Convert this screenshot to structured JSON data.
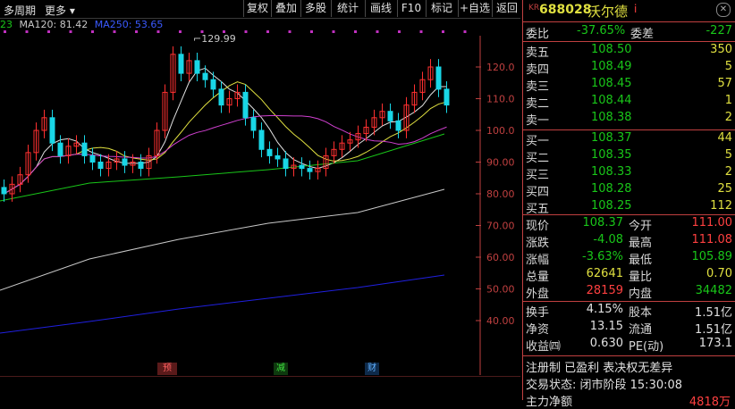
{
  "toolbar": {
    "period": "多周期",
    "more": "更多",
    "buttons": [
      "复权",
      "叠加",
      "多股",
      "统计",
      "画线",
      "F10",
      "标记",
      "+自选",
      "返回"
    ]
  },
  "ma_legend": {
    "prefix": "23",
    "ma120": "MA120: 81.42",
    "ma250": "MA250: 53.65"
  },
  "chart": {
    "high_label": "129.99",
    "y_ticks": [
      "120.0",
      "110.0",
      "100.0",
      "90.00",
      "80.00",
      "70.00",
      "60.00",
      "50.00",
      "40.00"
    ],
    "events": [
      "预",
      "减",
      "财"
    ],
    "colors": {
      "up": "#ff3030",
      "down": "#19d6e6",
      "ma5": "#e0e0e0",
      "ma10": "#e0e040",
      "ma20": "#d040d0",
      "ma60": "#19c619",
      "ma120": "#c8c8c8",
      "ma250": "#2020e0"
    }
  },
  "stock": {
    "badge": "KR",
    "code": "688028",
    "name": "沃尔德",
    "info_icon": "i"
  },
  "commission": {
    "ratio_label": "委比",
    "ratio": "-37.65%",
    "diff_label": "委差",
    "diff": "-227"
  },
  "asks": [
    {
      "label": "卖五",
      "price": "108.50",
      "vol": "350"
    },
    {
      "label": "卖四",
      "price": "108.49",
      "vol": "5"
    },
    {
      "label": "卖三",
      "price": "108.45",
      "vol": "57"
    },
    {
      "label": "卖二",
      "price": "108.44",
      "vol": "1"
    },
    {
      "label": "卖一",
      "price": "108.38",
      "vol": "2"
    }
  ],
  "bids": [
    {
      "label": "买一",
      "price": "108.37",
      "vol": "44"
    },
    {
      "label": "买二",
      "price": "108.35",
      "vol": "5"
    },
    {
      "label": "买三",
      "price": "108.33",
      "vol": "2"
    },
    {
      "label": "买四",
      "price": "108.28",
      "vol": "25"
    },
    {
      "label": "买五",
      "price": "108.25",
      "vol": "112"
    }
  ],
  "quote": [
    {
      "l1": "现价",
      "v1": "108.37",
      "l2": "今开",
      "v2": "111.00"
    },
    {
      "l1": "涨跌",
      "v1": "-4.08",
      "l2": "最高",
      "v2": "111.08"
    },
    {
      "l1": "涨幅",
      "v1": "-3.63%",
      "l2": "最低",
      "v2": "105.89"
    },
    {
      "l1": "总量",
      "v1": "62641",
      "l2": "量比",
      "v2": "0.70"
    },
    {
      "l1": "外盘",
      "v1": "28159",
      "l2": "内盘",
      "v2": "34482"
    }
  ],
  "fundamentals": [
    {
      "l1": "换手",
      "v1": "4.15%",
      "l2": "股本",
      "v2": "1.51亿"
    },
    {
      "l1": "净资",
      "v1": "13.15",
      "l2": "流通",
      "v2": "1.51亿"
    },
    {
      "l1": "收益㈣",
      "v1": "0.630",
      "l2": "PE(动)",
      "v2": "173.1"
    }
  ],
  "notes": {
    "registration": "注册制 已盈利 表决权无差异",
    "status": "交易状态: 闭市阶段 15:30:08",
    "flow_label": "主力净额",
    "flow_value": "4818万"
  }
}
